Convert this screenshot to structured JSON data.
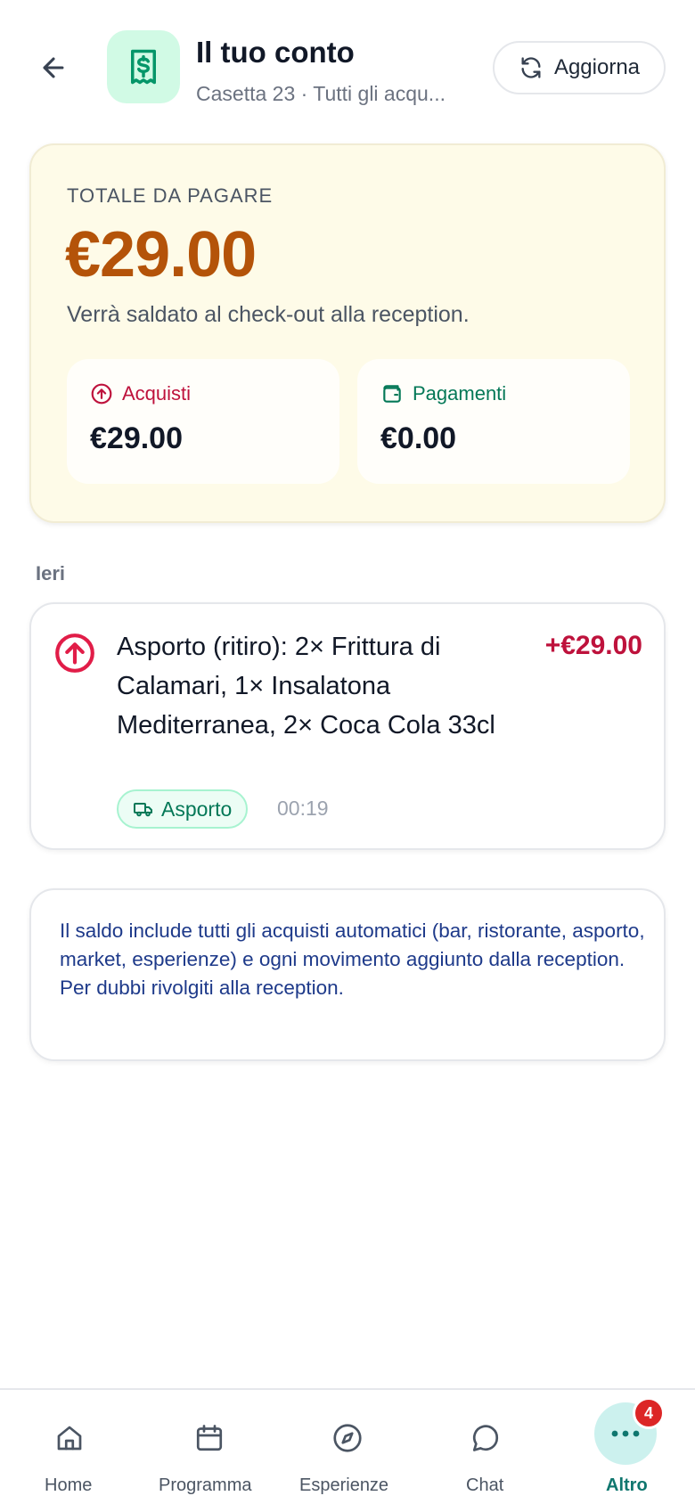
{
  "header": {
    "title": "Il tuo conto",
    "subtitle": "Casetta 23 · Tutti gli acqu...",
    "refresh_label": "Aggiorna"
  },
  "summary": {
    "label": "TOTALE DA PAGARE",
    "amount": "€29.00",
    "note": "Verrà saldato al check-out alla reception.",
    "purchases": {
      "label": "Acquisti",
      "value": "€29.00"
    },
    "payments": {
      "label": "Pagamenti",
      "value": "€0.00"
    }
  },
  "section": {
    "label": "Ieri"
  },
  "transactions": [
    {
      "description": "Asporto (ritiro): 2× Frittura di Calamari, 1× Insalatona Mediterranea, 2× Coca Cola 33cl",
      "amount": "+€29.00",
      "tag": "Asporto",
      "time": "00:19"
    }
  ],
  "info": {
    "text": "Il saldo include tutti gli acquisti automatici (bar, ristorante, asporto, market, esperienze) e ogni movimento aggiunto dalla reception. Per dubbi rivolgiti alla reception."
  },
  "nav": {
    "items": [
      {
        "label": "Home",
        "icon": "home-icon"
      },
      {
        "label": "Programma",
        "icon": "calendar-icon"
      },
      {
        "label": "Esperienze",
        "icon": "compass-icon"
      },
      {
        "label": "Chat",
        "icon": "chat-bubble-icon"
      },
      {
        "label": "Altro",
        "icon": "more-dots-icon",
        "badge": "4",
        "active": true
      }
    ]
  },
  "colors": {
    "accent": "#0f766e",
    "total": "#b45309",
    "purchase": "#be123c",
    "payment": "#047857",
    "summary_bg": "#fefbe8"
  }
}
